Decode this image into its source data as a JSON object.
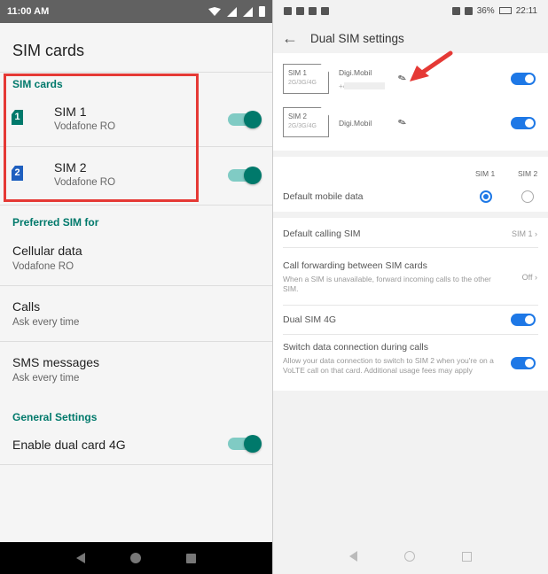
{
  "left": {
    "status": {
      "time": "11:00 AM"
    },
    "title": "SIM cards",
    "section_sim": "SIM cards",
    "sims": [
      {
        "label": "SIM 1",
        "carrier": "Vodafone RO",
        "badge": "1",
        "color": "#00796b",
        "enabled": true
      },
      {
        "label": "SIM 2",
        "carrier": "Vodafone RO",
        "badge": "2",
        "color": "#1e5fbf",
        "enabled": true
      }
    ],
    "section_pref": "Preferred SIM for",
    "prefs": [
      {
        "title": "Cellular data",
        "sub": "Vodafone RO"
      },
      {
        "title": "Calls",
        "sub": "Ask every time"
      },
      {
        "title": "SMS messages",
        "sub": "Ask every time"
      }
    ],
    "section_general": "General Settings",
    "dual_4g": {
      "label": "Enable dual card 4G",
      "enabled": true
    }
  },
  "right": {
    "status": {
      "time": "22:11",
      "battery": "36%"
    },
    "title": "Dual SIM settings",
    "sims": [
      {
        "card": "SIM 1",
        "bands": "2G/3G/4G",
        "carrier": "Digi.Mobil",
        "number_prefix": "+4",
        "enabled": true
      },
      {
        "card": "SIM 2",
        "bands": "2G/3G/4G",
        "carrier": "Digi.Mobil",
        "enabled": true
      }
    ],
    "col_sim1": "SIM 1",
    "col_sim2": "SIM 2",
    "default_data": {
      "label": "Default mobile data",
      "selected": "SIM 1"
    },
    "default_calling": {
      "label": "Default calling SIM",
      "value": "SIM 1"
    },
    "call_forward": {
      "label": "Call forwarding between SIM cards",
      "sub": "When a SIM is unavailable, forward incoming calls to the other SIM.",
      "value": "Off"
    },
    "dual_4g": {
      "label": "Dual SIM 4G",
      "enabled": true
    },
    "switch_data": {
      "label": "Switch data connection during calls",
      "sub": "Allow your data connection to switch to SIM 2 when you're on a VoLTE call on that card. Additional usage fees may apply",
      "enabled": true
    }
  },
  "colors": {
    "highlight_box": "#e53935",
    "android_accent": "#00796b",
    "emui_accent": "#1e78e6"
  }
}
